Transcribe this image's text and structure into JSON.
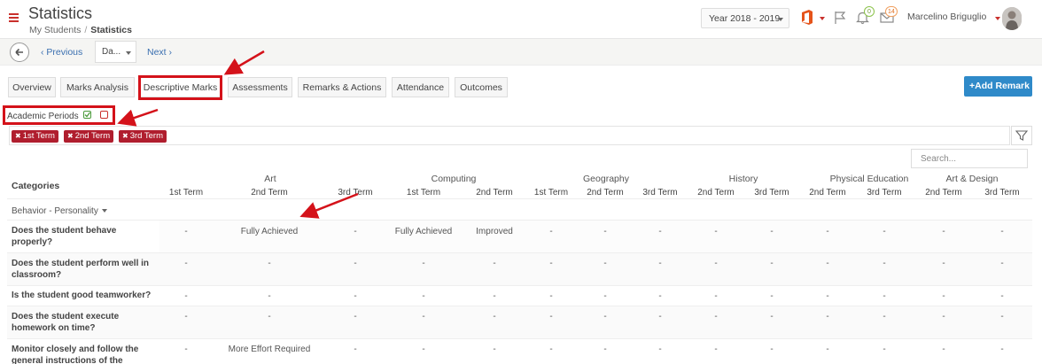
{
  "header": {
    "title": "Statistics",
    "breadcrumb": [
      "My Students",
      "Statistics"
    ],
    "year_select": "Year 2018 - 2019",
    "notifications_count": "0",
    "messages_count": "14",
    "user_name": "Marcelino Briguglio"
  },
  "nav": {
    "prev_label": "Previous",
    "date_select": "Da...",
    "next_label": "Next"
  },
  "tabs": [
    "Overview",
    "Marks Analysis",
    "Descriptive Marks",
    "Assessments",
    "Remarks & Actions",
    "Attendance",
    "Outcomes"
  ],
  "active_tab": "Descriptive Marks",
  "add_remark_label": "+Add Remark",
  "academic_periods": {
    "label": "Academic Periods",
    "chips": [
      "1st Term",
      "2nd Term",
      "3rd Term"
    ]
  },
  "search_placeholder": "Search...",
  "table": {
    "categories_label": "Categories",
    "subjects": [
      "Art",
      "Computing",
      "Geography",
      "History",
      "Physical Education",
      "Art & Design"
    ],
    "terms": [
      "1st Term",
      "2nd Term",
      "3rd Term",
      "1st Term",
      "2nd Term",
      "1st Term",
      "2nd Term",
      "3rd Term",
      "2nd Term",
      "3rd Term",
      "2nd Term",
      "3rd Term",
      "2nd Term",
      "3rd Term"
    ],
    "group": "Behavior - Personality",
    "rows": [
      {
        "label": "Does the student behave properly?",
        "values": [
          "-",
          "Fully Achieved",
          "-",
          "Fully Achieved",
          "Improved",
          "-",
          "-",
          "-",
          "-",
          "-",
          "-",
          "-",
          "-",
          "-"
        ]
      },
      {
        "label": "Does the student perform well in classroom?",
        "values": [
          "-",
          "-",
          "-",
          "-",
          "-",
          "-",
          "-",
          "-",
          "-",
          "-",
          "-",
          "-",
          "-",
          "-"
        ]
      },
      {
        "label": "Is the student good teamworker?",
        "values": [
          "-",
          "-",
          "-",
          "-",
          "-",
          "-",
          "-",
          "-",
          "-",
          "-",
          "-",
          "-",
          "-",
          "-"
        ]
      },
      {
        "label": "Does the student execute homework on time?",
        "values": [
          "-",
          "-",
          "-",
          "-",
          "-",
          "-",
          "-",
          "-",
          "-",
          "-",
          "-",
          "-",
          "-",
          "-"
        ]
      },
      {
        "label": "Monitor closely and follow the general instructions of the",
        "values": [
          "-",
          "More Effort Required",
          "-",
          "-",
          "-",
          "-",
          "-",
          "-",
          "-",
          "-",
          "-",
          "-",
          "-",
          "-"
        ]
      }
    ]
  },
  "colors": {
    "accent_red": "#c9302c",
    "chip_red": "#b01e2e",
    "button_blue": "#2f8ac9",
    "annotation_red": "#d4121a"
  }
}
